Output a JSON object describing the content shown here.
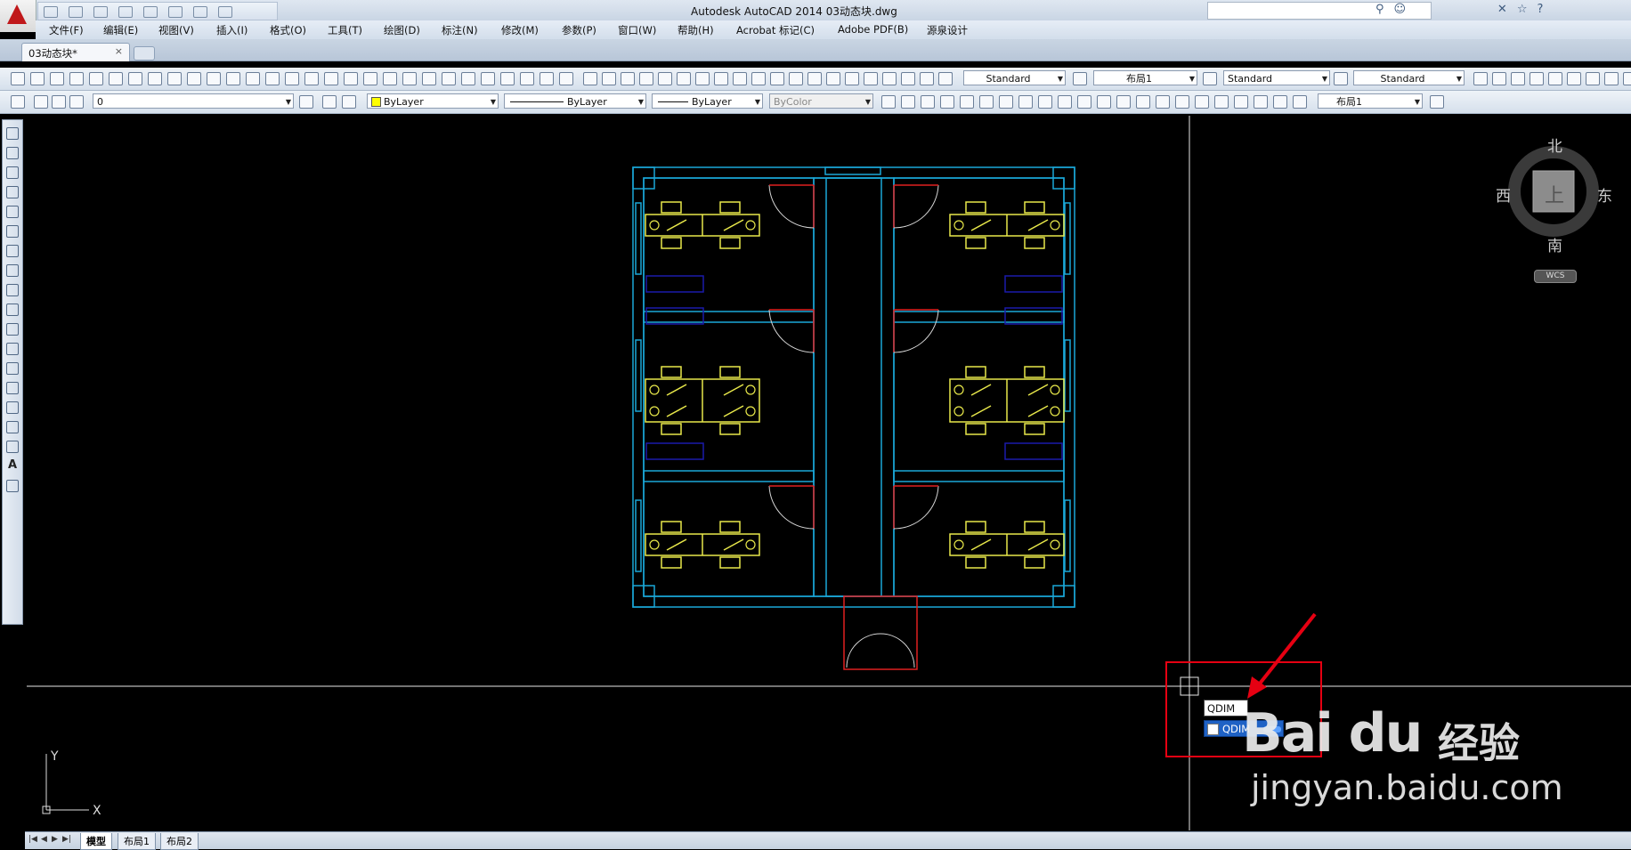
{
  "window": {
    "title": "Autodesk AutoCAD 2014    03动态块.dwg"
  },
  "menu": {
    "items": [
      "文件(F)",
      "编辑(E)",
      "视图(V)",
      "插入(I)",
      "格式(O)",
      "工具(T)",
      "绘图(D)",
      "标注(N)",
      "修改(M)",
      "参数(P)",
      "窗口(W)",
      "帮助(H)",
      "Acrobat 标记(C)",
      "Adobe PDF(B)",
      "源泉设计"
    ]
  },
  "tabs": {
    "document": "03动态块*",
    "close": "×"
  },
  "toolbar1": {
    "text_style": "Standard",
    "dim_style": "布局1",
    "table_style": "Standard",
    "mleader_style": "Standard"
  },
  "toolbar2": {
    "layer": "0",
    "color": "ByLayer",
    "linetype": "ByLayer",
    "lineweight": "ByLayer",
    "plotstyle": "ByColor",
    "layout": "布局1"
  },
  "left_toolbar": {
    "text_tool": "A"
  },
  "viewcube": {
    "north": "北",
    "south": "南",
    "east": "东",
    "west": "西",
    "face": "上",
    "wcs": "WCS"
  },
  "ucs": {
    "x": "X",
    "y": "Y"
  },
  "command": {
    "input_value": "QDIM",
    "suggestion": "QDIM"
  },
  "layout_tabs": [
    "模型",
    "布局1",
    "布局2"
  ],
  "watermark": {
    "brand": "Bai du",
    "jingyan": "经验",
    "url": "jingyan.baidu.com"
  },
  "colors": {
    "walls": "#1aa7d8",
    "furniture": "#e8e84a",
    "doors": "#e02020",
    "windows": "#1a1aaa",
    "highlight": "#e60012"
  }
}
